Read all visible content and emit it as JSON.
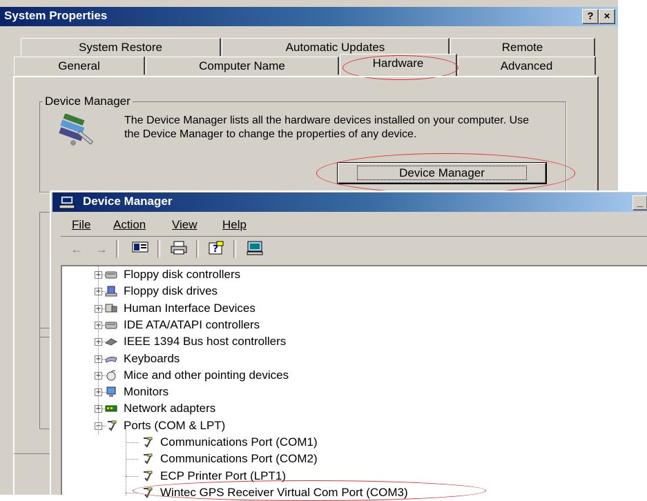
{
  "system_properties": {
    "title": "System Properties",
    "help_button": "?",
    "close_button": "×",
    "tabs_row1": [
      "System Restore",
      "Automatic Updates",
      "Remote"
    ],
    "tabs_row2": [
      "General",
      "Computer Name",
      "Hardware",
      "Advanced"
    ],
    "device_manager_group": {
      "label": "Device Manager",
      "description": "The Device Manager lists all the hardware devices installed on your computer. Use the Device Manager to change the properties of any device.",
      "button_label": "Device Manager"
    }
  },
  "device_manager": {
    "title": "Device Manager",
    "minimize_button": "_",
    "menu": [
      "File",
      "Action",
      "View",
      "Help"
    ],
    "toolbar": [
      "back-icon",
      "forward-icon",
      "properties-view-icon",
      "print-icon",
      "help-icon",
      "computer-icon"
    ],
    "tree": {
      "categories": [
        {
          "label": "Floppy disk controllers",
          "icon": "disk-controller-icon",
          "expander": "+"
        },
        {
          "label": "Floppy disk drives",
          "icon": "floppy-drive-icon",
          "expander": "+"
        },
        {
          "label": "Human Interface Devices",
          "icon": "hid-icon",
          "expander": "+"
        },
        {
          "label": "IDE ATA/ATAPI controllers",
          "icon": "ide-controller-icon",
          "expander": "+"
        },
        {
          "label": "IEEE 1394 Bus host controllers",
          "icon": "firewire-icon",
          "expander": "+"
        },
        {
          "label": "Keyboards",
          "icon": "keyboard-icon",
          "expander": "+"
        },
        {
          "label": "Mice and other pointing devices",
          "icon": "mouse-icon",
          "expander": "+"
        },
        {
          "label": "Monitors",
          "icon": "monitor-icon",
          "expander": "+"
        },
        {
          "label": "Network adapters",
          "icon": "network-adapter-icon",
          "expander": "+"
        },
        {
          "label": "Ports (COM & LPT)",
          "icon": "port-icon",
          "expander": "−"
        }
      ],
      "ports_children": [
        "Communications Port (COM1)",
        "Communications Port (COM2)",
        "ECP Printer Port (LPT1)",
        "Wintec GPS Receiver Virtual Com Port (COM3)"
      ]
    }
  },
  "colors": {
    "window_face": "#d4d0c8",
    "titlebar_start": "#0a246a",
    "titlebar_end": "#a6caf0",
    "highlight_annotation": "#e03030"
  }
}
